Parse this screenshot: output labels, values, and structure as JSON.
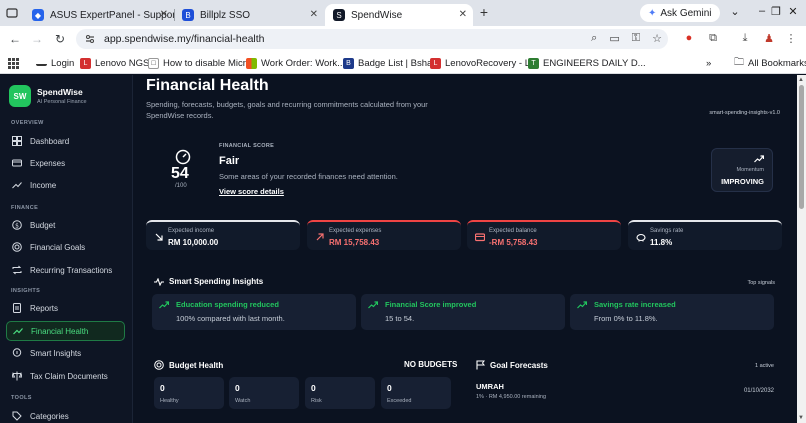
{
  "browser": {
    "tabs": [
      {
        "title": "ASUS ExpertPanel - Support",
        "active": false
      },
      {
        "title": "Billplz SSO",
        "active": false
      },
      {
        "title": "SpendWise",
        "active": true
      }
    ],
    "ask_gemini": "Ask Gemini",
    "url": "app.spendwise.my/financial-health",
    "bookmarks": [
      {
        "label": "Login"
      },
      {
        "label": "Lenovo NGSP"
      },
      {
        "label": "How to disable Micr..."
      },
      {
        "label": "Work Order: Work..."
      },
      {
        "label": "Badge List | Bsharp"
      },
      {
        "label": "LenovoRecovery - L..."
      },
      {
        "label": "ENGINEERS DAILY D..."
      }
    ],
    "more": "»",
    "all_bookmarks": "All Bookmarks"
  },
  "sidebar": {
    "brand_logo": "SW",
    "brand_name": "SpendWise",
    "brand_sub": "AI Personal Finance",
    "sections": {
      "overview": "OVERVIEW",
      "finance": "FINANCE",
      "insights": "INSIGHTS",
      "tools": "TOOLS"
    },
    "items": {
      "dashboard": "Dashboard",
      "expenses": "Expenses",
      "income": "Income",
      "budget": "Budget",
      "goals": "Financial Goals",
      "recurring": "Recurring Transactions",
      "reports": "Reports",
      "health": "Financial Health",
      "smart": "Smart Insights",
      "tax": "Tax Claim Documents",
      "categories": "Categories"
    }
  },
  "page": {
    "title": "Financial Health",
    "description": "Spending, forecasts, budgets, goals and recurring commitments calculated from your SpendWise records.",
    "version": "smart-spending-insights-v1.0"
  },
  "score": {
    "value": "54",
    "denominator": "/100",
    "label": "FINANCIAL SCORE",
    "grade": "Fair",
    "message": "Some areas of your recorded finances need attention.",
    "link": "View score details"
  },
  "momentum": {
    "label": "Momentum",
    "value": "IMPROVING"
  },
  "stats": [
    {
      "label": "Expected income",
      "value": "RM 10,000.00"
    },
    {
      "label": "Expected expenses",
      "value": "RM 15,758.43"
    },
    {
      "label": "Expected balance",
      "value": "-RM 5,758.43"
    },
    {
      "label": "Savings rate",
      "value": "11.8%"
    }
  ],
  "insights": {
    "title": "Smart Spending Insights",
    "note": "Top signals",
    "items": [
      {
        "title": "Education spending reduced",
        "desc": "100% compared with last month."
      },
      {
        "title": "Financial Score improved",
        "desc": "15 to 54."
      },
      {
        "title": "Savings rate increased",
        "desc": "From 0% to 11.8%."
      }
    ]
  },
  "budget_health": {
    "title": "Budget Health",
    "status": "NO BUDGETS",
    "cards": [
      {
        "value": "0",
        "label": "Healthy"
      },
      {
        "value": "0",
        "label": "Watch"
      },
      {
        "value": "0",
        "label": "Risk"
      },
      {
        "value": "0",
        "label": "Exceeded"
      }
    ]
  },
  "goal_forecasts": {
    "title": "Goal Forecasts",
    "count": "1 active",
    "goal": {
      "name": "UMRAH",
      "sub": "1% · RM 4,950.00 remaining",
      "date": "01/10/2032"
    }
  },
  "colors": {
    "accent": "#22c55e",
    "danger": "#ef4444",
    "bg": "#0b1220"
  }
}
